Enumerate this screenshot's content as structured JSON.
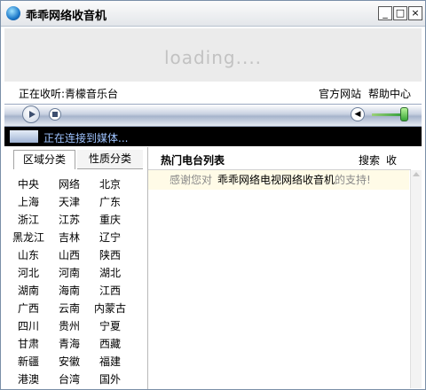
{
  "window": {
    "title": "乖乖网络收音机",
    "min_label": "_",
    "max_label": "□",
    "close_label": "×"
  },
  "banner": {
    "loading_text": "loading...."
  },
  "now_playing": {
    "label": "正在收听:青檬音乐台"
  },
  "top_links": [
    "官方网站",
    "帮助中心"
  ],
  "status": {
    "text": "正在连接到媒体..."
  },
  "tabs": [
    {
      "label": "区域分类"
    },
    {
      "label": "性质分类"
    }
  ],
  "regions": [
    "中央",
    "网络",
    "北京",
    "上海",
    "天津",
    "广东",
    "浙江",
    "江苏",
    "重庆",
    "黑龙江",
    "吉林",
    "辽宁",
    "山东",
    "山西",
    "陕西",
    "河北",
    "河南",
    "湖北",
    "湖南",
    "海南",
    "江西",
    "广西",
    "云南",
    "内蒙古",
    "四川",
    "贵州",
    "宁夏",
    "甘肃",
    "青海",
    "西藏",
    "新疆",
    "安徽",
    "福建",
    "港澳",
    "台湾",
    "国外"
  ],
  "station_list": {
    "title": "热门电台列表",
    "links": [
      "搜索",
      "收藏"
    ],
    "notice_prefix": "感谢您对",
    "notice_highlight": "乖乖网络电视网络收音机",
    "notice_suffix": "的支持!"
  },
  "colors": {
    "accent": "#1c78c9",
    "status_bg": "#000000",
    "status_text": "#9ec3ff",
    "notice_bg": "#fffbe7"
  },
  "icons": {
    "app": "radio-globe-icon",
    "play": "play-icon",
    "stop": "stop-icon",
    "volume": "speaker-icon"
  }
}
